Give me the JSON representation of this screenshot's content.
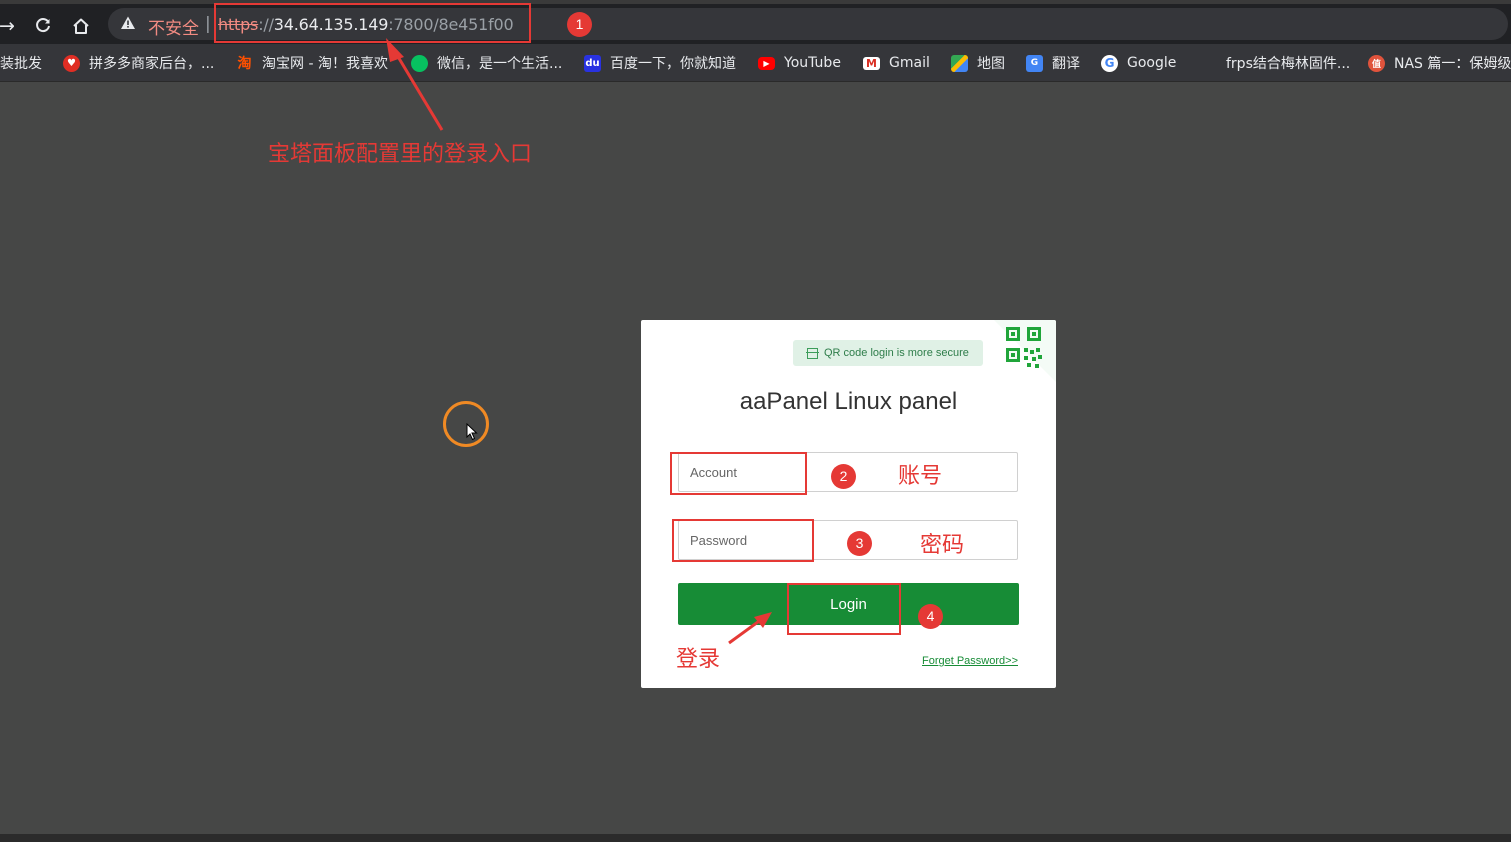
{
  "browser": {
    "security_label": "不安全",
    "omnibox_separator": "|",
    "url": {
      "scheme": "https",
      "separator": "://",
      "host": "34.64.135.149",
      "rest": ":7800/8e451f00"
    },
    "bookmarks": [
      {
        "label": "装批发",
        "icon": "none"
      },
      {
        "label": "拼多多商家后台，...",
        "icon": "pinduoduo-icon"
      },
      {
        "label": "淘宝网 - 淘！我喜欢",
        "icon": "taobao-icon"
      },
      {
        "label": "微信，是一个生活...",
        "icon": "wechat-icon"
      },
      {
        "label": "百度一下，你就知道",
        "icon": "baidu-icon"
      },
      {
        "label": "YouTube",
        "icon": "youtube-icon"
      },
      {
        "label": "Gmail",
        "icon": "gmail-icon"
      },
      {
        "label": "地图",
        "icon": "maps-icon"
      },
      {
        "label": "翻译",
        "icon": "translate-icon"
      },
      {
        "label": "Google",
        "icon": "google-icon"
      },
      {
        "label": "frps结合梅林固件...",
        "icon": "none"
      },
      {
        "label": "NAS 篇一：保姆级",
        "icon": "nas-icon"
      }
    ]
  },
  "login": {
    "qr_tip": "QR code login is more secure",
    "title": "aaPanel Linux panel",
    "account_placeholder": "Account",
    "password_placeholder": "Password",
    "login_label": "Login",
    "forgot_label": "Forget Password>>"
  },
  "annotations": {
    "num_1": "1",
    "num_2": "2",
    "num_3": "3",
    "num_4": "4",
    "entry_note": "宝塔面板配置里的登录入口",
    "account_note": "账号",
    "password_note": "密码",
    "login_note": "登录"
  },
  "colors": {
    "annotation": "#e53935",
    "login_button": "#178c36",
    "page_background": "#464746",
    "cursor_ring": "#f08a24"
  }
}
